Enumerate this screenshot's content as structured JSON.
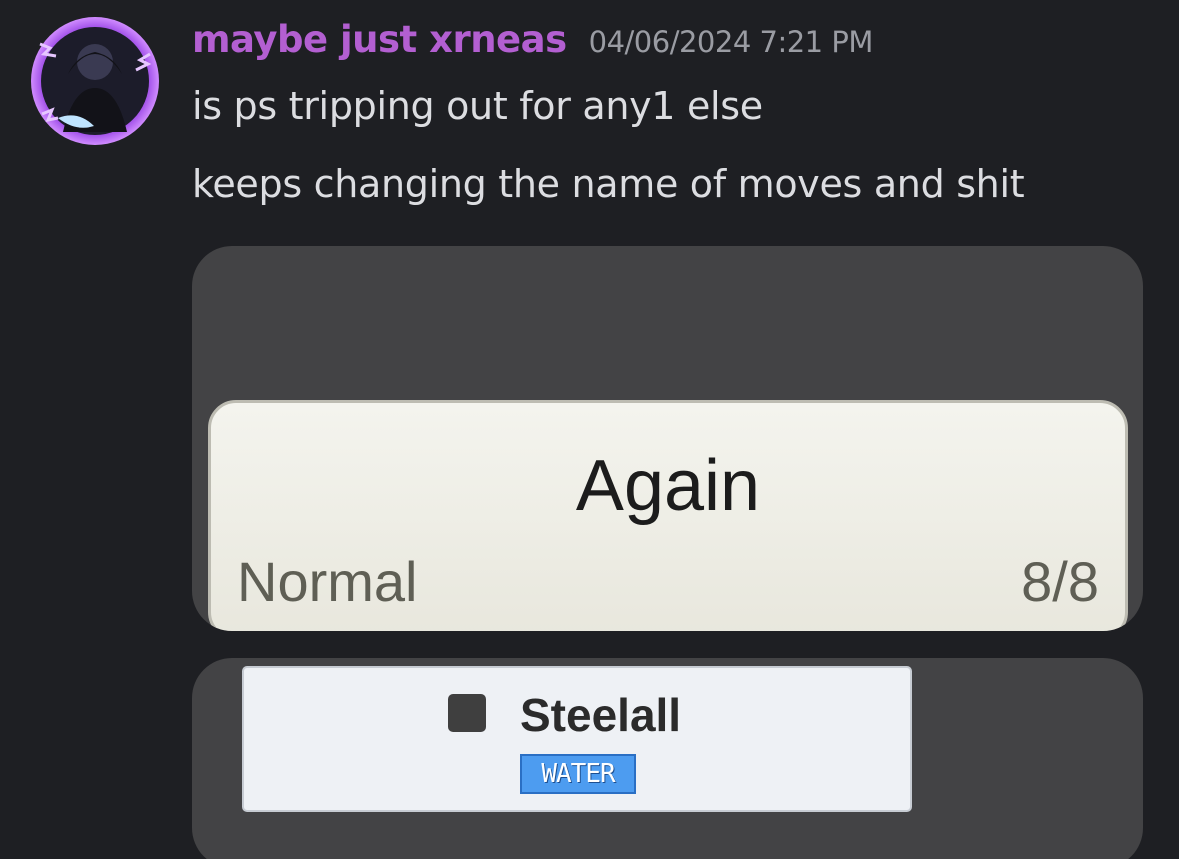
{
  "message": {
    "username": "maybe just xrneas",
    "timestamp": "04/06/2024 7:21 PM",
    "lines": [
      "is ps tripping out for any1 else",
      "keeps changing the name of moves and shit"
    ]
  },
  "attachments": {
    "move": {
      "name": "Again",
      "type": "Normal",
      "pp": "8/8"
    },
    "pokemon": {
      "name": "Steelall",
      "type_badge": "WATER"
    }
  },
  "colors": {
    "background": "#1e1f23",
    "username": "#b35fd1",
    "timestamp": "#9a9ca3",
    "text": "#dcdde1",
    "avatar_ring": "#a23ee6"
  }
}
